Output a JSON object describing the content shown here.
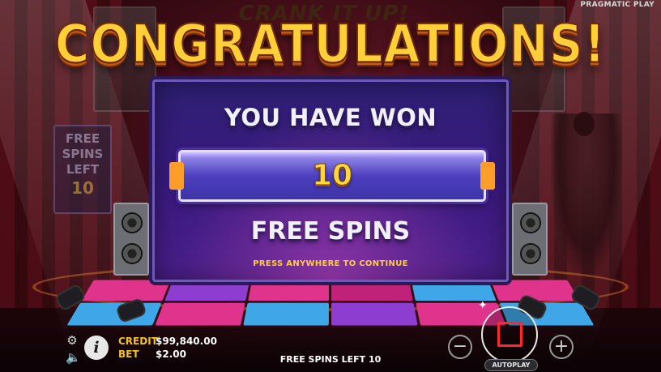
{
  "brand": "PRAGMATIC PLAY",
  "game_logo": "CRANK IT UP!",
  "background_card": {
    "line1": "FREE",
    "line2": "SPINS",
    "line3": "LEFT",
    "value": "10"
  },
  "dialog": {
    "title": "CONGRATULATIONS!",
    "subtitle": "YOU HAVE WON",
    "win_amount": "10",
    "win_unit": "FREE SPINS",
    "hint": "PRESS ANYWHERE TO CONTINUE"
  },
  "status": {
    "credit_label": "CREDIT",
    "credit_value": "$99,840.00",
    "bet_label": "BET",
    "bet_value": "$2.00",
    "free_spins_left": "FREE SPINS LEFT 10"
  },
  "controls": {
    "minus": "−",
    "plus": "+",
    "autoplay_label": "AUTOPLAY",
    "info": "i",
    "settings_icon": "gear-icon",
    "sound_icon": "speaker-icon"
  },
  "colors": {
    "accent_gold": "#ffcf3a",
    "panel_purple": "#3a1a80",
    "spin_red": "#ff2a2a",
    "label_yellow": "#f2c21a"
  }
}
